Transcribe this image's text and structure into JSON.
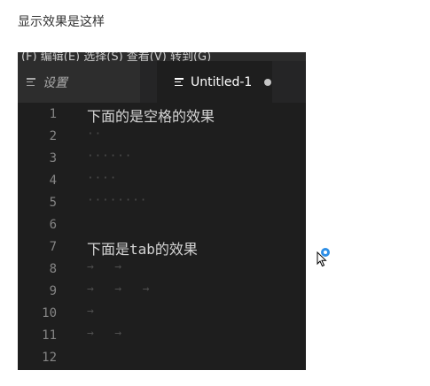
{
  "caption": "显示效果是这样",
  "editor": {
    "menu_strip": "(F)  编辑(E)  选择(S)  查看(V)  转到(G)",
    "tabs": [
      {
        "label": "设置",
        "active": false,
        "icon": "file-lines-icon"
      },
      {
        "label": "Untitled-1",
        "active": true,
        "icon": "file-lines-icon",
        "modified": true
      }
    ],
    "lines": [
      {
        "num": "1",
        "text": "下面的是空格的效果"
      },
      {
        "num": "2",
        "whitespace": "··"
      },
      {
        "num": "3",
        "whitespace": "······"
      },
      {
        "num": "4",
        "whitespace": "····"
      },
      {
        "num": "5",
        "whitespace": "········"
      },
      {
        "num": "6"
      },
      {
        "num": "7",
        "text": "下面是tab的效果"
      },
      {
        "num": "8",
        "tabs": "→   →"
      },
      {
        "num": "9",
        "tabs": "→   →   →"
      },
      {
        "num": "10",
        "tabs": "→"
      },
      {
        "num": "11",
        "tabs": "→   →"
      },
      {
        "num": "12"
      }
    ]
  },
  "colors": {
    "editor_bg": "#1e1e1e",
    "tabbar_bg": "#252526",
    "line_number": "#858585",
    "text": "#d4d4d4",
    "whitespace_marker": "#4a4a4a",
    "cursor_accent": "#2f8fe6"
  }
}
